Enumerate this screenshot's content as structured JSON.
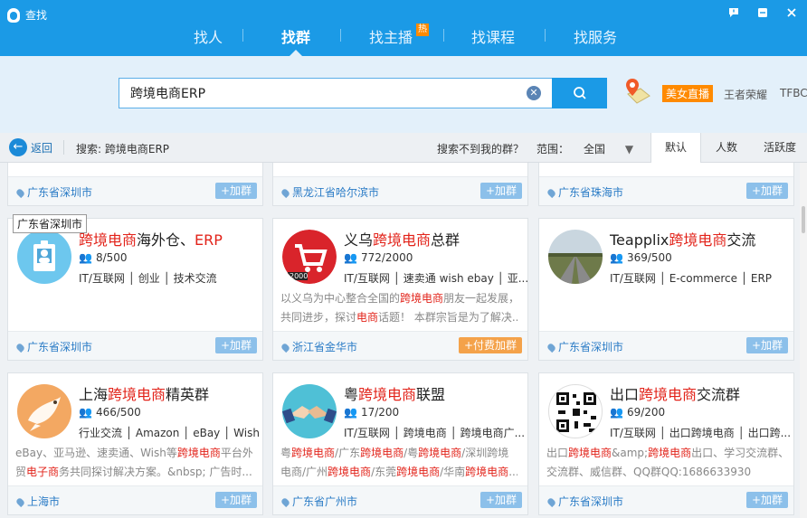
{
  "app": {
    "title": "查找"
  },
  "nav": {
    "tabs": [
      "找人",
      "找群",
      "找主播",
      "找课程",
      "找服务"
    ],
    "hot_badge": "热",
    "active": "找群"
  },
  "search": {
    "query": "跨境电商ERP"
  },
  "promo": {
    "live_label": "美女直播",
    "game_label": "王者荣耀",
    "extra_label": "TFBC"
  },
  "filter": {
    "back_label": "返回",
    "search_prefix": "搜索: 跨境电商ERP",
    "not_found": "搜索不到我的群？",
    "scope_label": "范围：",
    "scope_value": "全国",
    "sort_tabs": [
      "默认",
      "人数",
      "活跃度"
    ]
  },
  "tooltip": "广东省深圳市",
  "top_row": [
    {
      "location": "广东省深圳市",
      "add": "+加群"
    },
    {
      "location": "黑龙江省哈尔滨市",
      "add": "+加群"
    },
    {
      "location": "广东省珠海市",
      "add": "+加群"
    }
  ],
  "groups": [
    {
      "name_pre": "",
      "name_hl": "跨境电商",
      "name_post": "海外仓、",
      "name_hl2": "ERP",
      "members": "8/500",
      "tags": "IT/互联网 │ 创业 │ 技术交流",
      "desc1": "",
      "desc2": "",
      "location": "广东省深圳市",
      "add": "+加群"
    },
    {
      "name_pre": "义乌",
      "name_hl": "跨境电商",
      "name_post": "总群",
      "name_hl2": "",
      "members": "772/2000",
      "tags": "IT/互联网 │ 速卖通 wish ebay │ 亚...",
      "desc1": "以义乌为中心整合全国的跨境电商朋友一起发展，",
      "desc2": "共同进步，探讨电商话题！ 本群宗旨是为了解决...",
      "location": "浙江省金华市",
      "add": "+付费加群"
    },
    {
      "name_pre": "Teapplix",
      "name_hl": "跨境电商",
      "name_post": "交流",
      "name_hl2": "",
      "members": "369/500",
      "tags": "IT/互联网 │ E-commerce │ ERP",
      "desc1": "",
      "desc2": "",
      "location": "广东省深圳市",
      "add": "+加群"
    },
    {
      "name_pre": "上海",
      "name_hl": "跨境电商",
      "name_post": "精英群",
      "name_hl2": "",
      "members": "466/500",
      "tags": "行业交流 │ Amazon │ eBay │ Wish │ ...",
      "desc1": "eBay、亚马逊、速卖通、Wish等跨境电商平台外",
      "desc2": "贸电子商务共同探讨解决方案。&nbsp; 广告时...",
      "location": "上海市",
      "add": "+加群"
    },
    {
      "name_pre": "粤",
      "name_hl": "跨境电商",
      "name_post": "联盟",
      "name_hl2": "",
      "members": "17/200",
      "tags": "IT/互联网 │ 跨境电商 │ 跨境电商广...",
      "desc1": "粤跨境电商/广东跨境电商/粤跨境电商/深圳跨境",
      "desc2": "电商/广州跨境电商/东莞跨境电商/华南跨境电商...",
      "location": "广东省广州市",
      "add": "+加群"
    },
    {
      "name_pre": "出口",
      "name_hl": "跨境电商",
      "name_post": "交流群",
      "name_hl2": "",
      "members": "69/200",
      "tags": "IT/互联网 │ 出口跨境电商 │ 出口跨...",
      "desc1": "出口跨境电商&amp;跨境电商出口、学习交流群、",
      "desc2": "交流群、威信群、QQ群QQ:1686633930",
      "location": "广东省深圳市",
      "add": "+加群"
    }
  ],
  "colors": {
    "brand": "#1b9ae6",
    "highlight": "#e2231a",
    "hot": "#ff8a00"
  }
}
